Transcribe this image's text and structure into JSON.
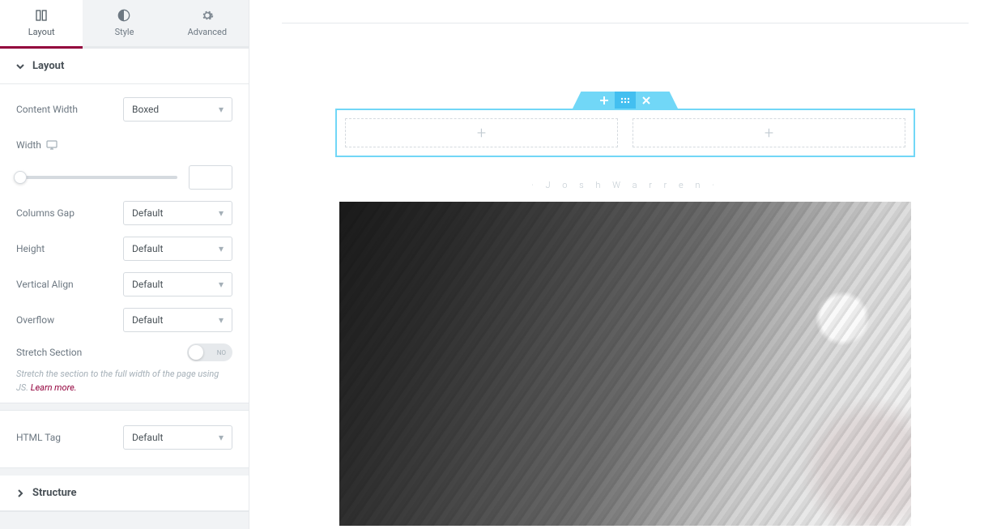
{
  "tabs": {
    "layout": "Layout",
    "style": "Style",
    "advanced": "Advanced"
  },
  "sections": {
    "layout": "Layout",
    "structure": "Structure"
  },
  "controls": {
    "content_width": {
      "label": "Content Width",
      "value": "Boxed"
    },
    "width": {
      "label": "Width",
      "value": ""
    },
    "columns_gap": {
      "label": "Columns Gap",
      "value": "Default"
    },
    "height": {
      "label": "Height",
      "value": "Default"
    },
    "vertical_align": {
      "label": "Vertical Align",
      "value": "Default"
    },
    "overflow": {
      "label": "Overflow",
      "value": "Default"
    },
    "stretch_section": {
      "label": "Stretch Section",
      "state": "NO"
    },
    "stretch_help": {
      "text": "Stretch the section to the full width of the page using JS. ",
      "link": "Learn more."
    },
    "html_tag": {
      "label": "HTML Tag",
      "value": "Default"
    }
  },
  "canvas": {
    "figure_name": "· J o s h   W a r r e n ·"
  }
}
